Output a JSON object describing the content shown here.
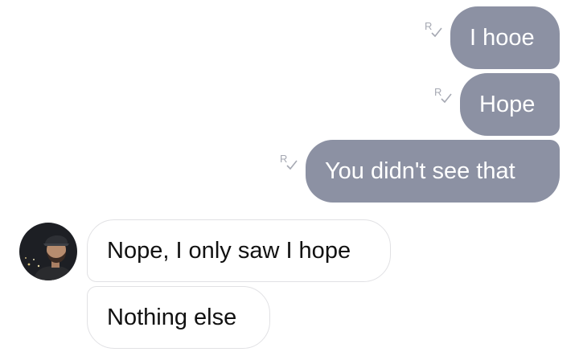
{
  "messages": {
    "outgoing": [
      {
        "text": "I hooe",
        "receipt": "R"
      },
      {
        "text": "Hope",
        "receipt": "R"
      },
      {
        "text": "You didn't see that",
        "receipt": "R"
      }
    ],
    "incoming": [
      {
        "text": "Nope, I only saw I hope"
      },
      {
        "text": "Nothing else"
      }
    ]
  },
  "contact": {
    "avatar_icon": "person-avatar"
  },
  "colors": {
    "outgoing_bubble": "#8c91a3",
    "outgoing_text": "#ffffff",
    "incoming_bubble": "#ffffff",
    "incoming_border": "#e1e1e4",
    "incoming_text": "#111111",
    "receipt": "#a6a9b3"
  }
}
